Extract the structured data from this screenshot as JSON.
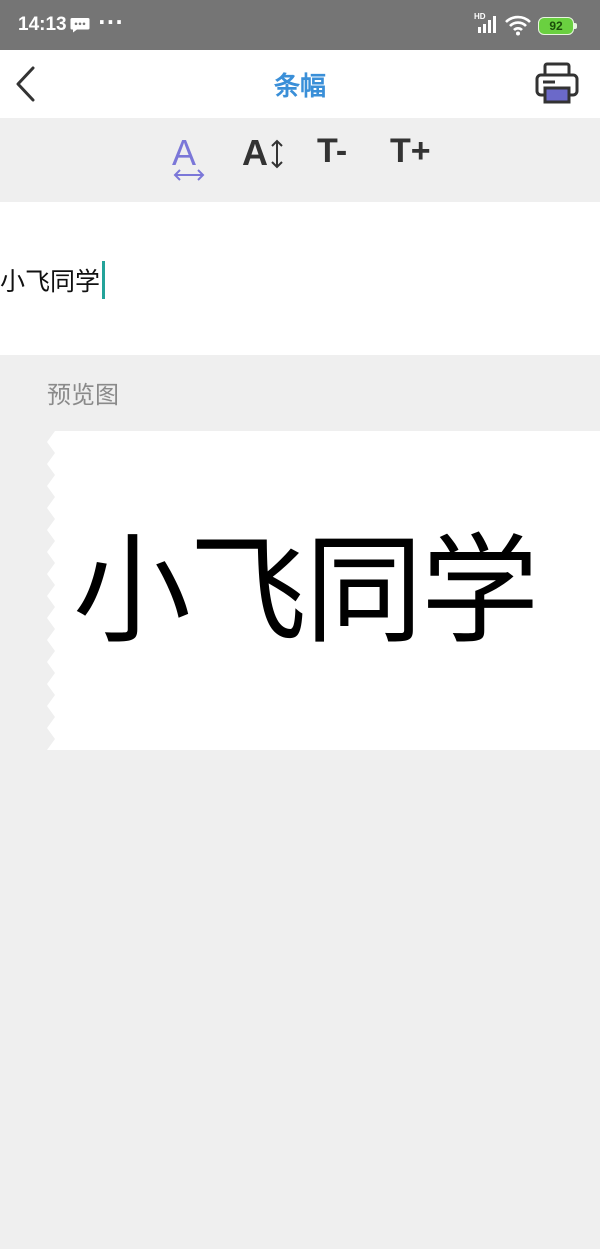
{
  "status_bar": {
    "time": "14:13",
    "more": "···",
    "network_label": "HD",
    "battery_level": "92",
    "icons": [
      "message-icon",
      "signal-icon",
      "wifi-icon",
      "battery-icon"
    ]
  },
  "header": {
    "title": "条幅",
    "back_icon": "chevron-left-icon",
    "print_icon": "printer-icon"
  },
  "toolbar": {
    "font_width_label": "A",
    "font_height_label": "A",
    "decrease_label": "T-",
    "increase_label": "T+",
    "accent_color": "#7b77d8"
  },
  "input": {
    "value": "小飞同学"
  },
  "preview": {
    "label": "预览图",
    "text": "小飞同学"
  },
  "colors": {
    "title": "#3a8fd8",
    "cursor": "#23a39a",
    "status_bar": "#757575",
    "battery": "#6ad040"
  }
}
